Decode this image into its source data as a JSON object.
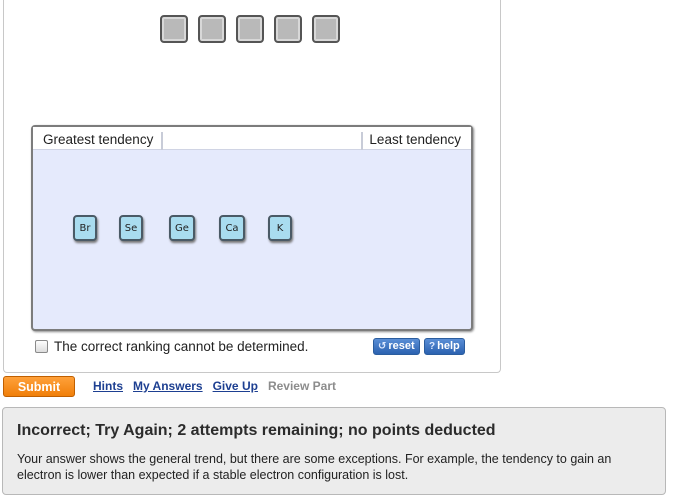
{
  "ranking": {
    "header_left": "Greatest tendency",
    "header_right": "Least tendency",
    "slot_count": 5,
    "items": [
      "Br",
      "Se",
      "Ge",
      "Ca",
      "K"
    ]
  },
  "cannot_determine": {
    "label": "The correct ranking cannot be determined.",
    "checked": false
  },
  "tools": {
    "reset_label": "reset",
    "reset_icon": "reset-icon",
    "help_label": "help",
    "help_icon": "question-mark-icon"
  },
  "actions": {
    "submit_label": "Submit",
    "hints_label": "Hints",
    "my_answers_label": "My Answers",
    "give_up_label": "Give Up",
    "review_part_label": "Review Part"
  },
  "feedback": {
    "title": "Incorrect; Try Again; 2 attempts remaining; no points deducted",
    "message": "Your answer shows the general trend, but there are some exceptions. For example, the tendency to gain an electron is lower than expected if a stable electron configuration is lost."
  },
  "colors": {
    "tile_fill": "#a9dcef",
    "rank_area": "#e5eafc",
    "submit": "#f07f0a",
    "tool_button": "#2b62b0",
    "link": "#1d3f91"
  }
}
